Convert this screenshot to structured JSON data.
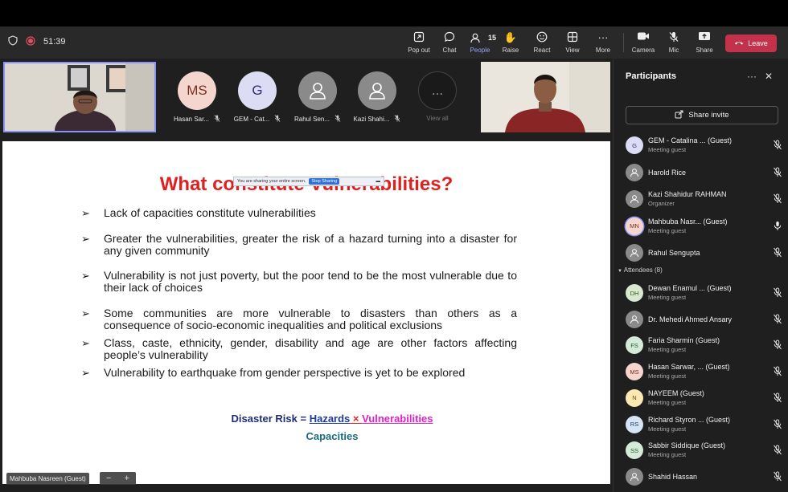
{
  "call": {
    "timer": "51:39"
  },
  "controls": {
    "popout": "Pop out",
    "chat": "Chat",
    "people": "People",
    "people_count": "15",
    "raise": "Raise",
    "react": "React",
    "view": "View",
    "more": "More",
    "camera": "Camera",
    "mic": "Mic",
    "share": "Share",
    "leave": "Leave"
  },
  "gallery": [
    {
      "initials": "MS",
      "name": "Hasan Sar...",
      "bg": "#f4d6cf",
      "fg": "#7a2e1f"
    },
    {
      "initials": "G",
      "name": "GEM - Cat...",
      "bg": "#dcdcf5",
      "fg": "#2d2f74"
    },
    {
      "initials": "",
      "name": "Rahul Sen...",
      "bg": "#8a8a8a",
      "fg": "#fff"
    },
    {
      "initials": "",
      "name": "Kazi Shahi...",
      "bg": "#8a8a8a",
      "fg": "#fff"
    },
    {
      "initials": "...",
      "name": "View all",
      "bg": "#1a1a1a",
      "fg": "#999"
    }
  ],
  "slide": {
    "title": "What constitute Vulnerabilities?",
    "sharing_notice": "You are sharing your entire screen.",
    "stop_sharing": "Stop Sharing",
    "bullets": [
      "Lack of capacities constitute vulnerabilities",
      "Greater the vulnerabilities, greater the risk of a hazard turning into a disaster for any given community",
      "Vulnerability is not just poverty, but the poor tend to be the most vulnerable due to their lack of choices",
      "Some communities are more vulnerable to disasters than others as a consequence of socio-economic inequalities and political exclusions",
      "Class, caste, ethnicity, gender, disability and age are other factors affecting people’s vulnerability",
      "Vulnerability to earthquake from gender perspective is yet to be explored"
    ],
    "formula": {
      "lhs": "Disaster Risk = ",
      "hazards": "Hazards",
      "times": " × ",
      "vuln": "Vulnerabilities",
      "denominator": "Capacities"
    }
  },
  "presenter_label": "Mahbuba Nasreen (Guest)",
  "zoom": {
    "minus": "−",
    "plus": "+"
  },
  "panel": {
    "title": "Participants",
    "share_invite": "Share invite",
    "attendees_header": "Attendees (8)",
    "participants": [
      {
        "initials": "G",
        "name": "GEM - Catalina ... (Guest)",
        "sub": "Meeting guest",
        "bg": "#dcdcf5",
        "fg": "#2d2f74",
        "muted": true
      },
      {
        "initials": "",
        "name": "Harold Rice",
        "sub": "",
        "bg": "#8a8a8a",
        "fg": "#fff",
        "muted": true
      },
      {
        "initials": "",
        "name": "Kazi Shahidur RAHMAN",
        "sub": "Organizer",
        "bg": "#8a8a8a",
        "fg": "#fff",
        "muted": true
      },
      {
        "initials": "MN",
        "name": "Mahbuba Nasr... (Guest)",
        "sub": "Meeting guest",
        "bg": "#f4d6cf",
        "fg": "#7a2e1f",
        "muted": false
      },
      {
        "initials": "",
        "name": "Rahul Sengupta",
        "sub": "",
        "bg": "#8a8a8a",
        "fg": "#fff",
        "muted": true
      }
    ],
    "attendees": [
      {
        "initials": "DH",
        "name": "Dewan Enamul ... (Guest)",
        "sub": "Meeting guest",
        "bg": "#d9e8cf",
        "fg": "#2e5a1e",
        "muted": true
      },
      {
        "initials": "",
        "name": "Dr. Mehedi Ahmed Ansary",
        "sub": "",
        "bg": "#8a8a8a",
        "fg": "#fff",
        "muted": true
      },
      {
        "initials": "FS",
        "name": "Faria Sharmin (Guest)",
        "sub": "Meeting guest",
        "bg": "#d5ead8",
        "fg": "#1e5a2a",
        "muted": true
      },
      {
        "initials": "MS",
        "name": "Hasan Sarwar, ... (Guest)",
        "sub": "Meeting guest",
        "bg": "#f4d6cf",
        "fg": "#7a2e1f",
        "muted": true
      },
      {
        "initials": "N",
        "name": "NAYEEM (Guest)",
        "sub": "Meeting guest",
        "bg": "#fbe8b2",
        "fg": "#6b4f00",
        "muted": true
      },
      {
        "initials": "RS",
        "name": "Richard Styron ... (Guest)",
        "sub": "Meeting guest",
        "bg": "#d6e4f4",
        "fg": "#1e3f6b",
        "muted": true
      },
      {
        "initials": "SS",
        "name": "Sabbir Siddique (Guest)",
        "sub": "Meeting guest",
        "bg": "#d5ead8",
        "fg": "#1e5a2a",
        "muted": true
      },
      {
        "initials": "",
        "name": "Shahid Hassan",
        "sub": "",
        "bg": "#8a8a8a",
        "fg": "#fff",
        "muted": true
      }
    ]
  },
  "colors": {
    "accent": "#9aa3ff",
    "leave": "#c4314b",
    "title_red": "#e02020",
    "hazards_blue": "#1f3a9a",
    "vuln_magenta": "#e020c8",
    "capacities_teal": "#1a6b7b"
  }
}
